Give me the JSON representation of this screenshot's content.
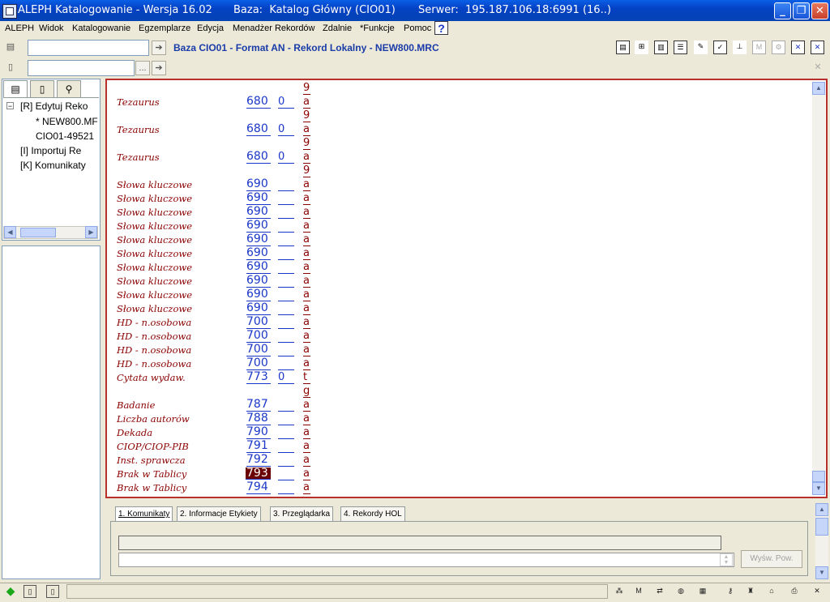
{
  "window": {
    "title": "ALEPH Katalogowanie - Wersja 16.02",
    "base_label": "Baza:  Katalog Główny (CIO01)",
    "server_label": "Serwer:  195.187.106.18:6991 (16..)",
    "min_icon": "minimize-icon",
    "max_icon": "restore-icon",
    "close_icon": "close-icon"
  },
  "menu": {
    "items": [
      "ALEPH",
      "Widok",
      "Katalogowanie",
      "Egzemplarze",
      "Edycja",
      "Menadżer Rekordów",
      "Zdalnie",
      "*Funkcje",
      "Pomoc"
    ],
    "help_glyph": "?"
  },
  "toolbar": {
    "record_title": "Baza CIO01 - Format AN - Rekord Lokalny - NEW800.MRC",
    "input1_value": "",
    "input2_value": "",
    "browse_label": "..."
  },
  "tree": {
    "items": [
      {
        "text": "[R] Edytuj Reko"
      },
      {
        "text": "* NEW800.MF"
      },
      {
        "text": "CIO01-49521"
      },
      {
        "text": "[I] Importuj Re"
      },
      {
        "text": "[K] Komunikaty"
      }
    ]
  },
  "editor": {
    "rows": [
      {
        "label": "",
        "tag": "",
        "ind": "",
        "sub": "9"
      },
      {
        "label": "Tezaurus",
        "tag": "680",
        "ind": "0",
        "sub": "a"
      },
      {
        "label": "",
        "tag": "",
        "ind": "",
        "sub": "9"
      },
      {
        "label": "Tezaurus",
        "tag": "680",
        "ind": "0",
        "sub": "a"
      },
      {
        "label": "",
        "tag": "",
        "ind": "",
        "sub": "9"
      },
      {
        "label": "Tezaurus",
        "tag": "680",
        "ind": "0",
        "sub": "a"
      },
      {
        "label": "",
        "tag": "",
        "ind": "",
        "sub": "9"
      },
      {
        "label": "Słowa kluczowe",
        "tag": "690",
        "ind": "",
        "sub": "a"
      },
      {
        "label": "Słowa kluczowe",
        "tag": "690",
        "ind": "",
        "sub": "a"
      },
      {
        "label": "Słowa kluczowe",
        "tag": "690",
        "ind": "",
        "sub": "a"
      },
      {
        "label": "Słowa kluczowe",
        "tag": "690",
        "ind": "",
        "sub": "a"
      },
      {
        "label": "Słowa kluczowe",
        "tag": "690",
        "ind": "",
        "sub": "a"
      },
      {
        "label": "Słowa kluczowe",
        "tag": "690",
        "ind": "",
        "sub": "a"
      },
      {
        "label": "Słowa kluczowe",
        "tag": "690",
        "ind": "",
        "sub": "a"
      },
      {
        "label": "Słowa kluczowe",
        "tag": "690",
        "ind": "",
        "sub": "a"
      },
      {
        "label": "Słowa kluczowe",
        "tag": "690",
        "ind": "",
        "sub": "a"
      },
      {
        "label": "Słowa kluczowe",
        "tag": "690",
        "ind": "",
        "sub": "a"
      },
      {
        "label": "HD - n.osobowa",
        "tag": "700",
        "ind": "",
        "sub": "a"
      },
      {
        "label": "HD - n.osobowa",
        "tag": "700",
        "ind": "",
        "sub": "a"
      },
      {
        "label": "HD - n.osobowa",
        "tag": "700",
        "ind": "",
        "sub": "a"
      },
      {
        "label": "HD - n.osobowa",
        "tag": "700",
        "ind": "",
        "sub": "a"
      },
      {
        "label": "Cytata wydaw.",
        "tag": "773",
        "ind": "0",
        "sub": "t"
      },
      {
        "label": "",
        "tag": "",
        "ind": "",
        "sub": "g"
      },
      {
        "label": "Badanie",
        "tag": "787",
        "ind": "",
        "sub": "a"
      },
      {
        "label": "Liczba autorów",
        "tag": "788",
        "ind": "",
        "sub": "a"
      },
      {
        "label": "Dekada",
        "tag": "790",
        "ind": "",
        "sub": "a"
      },
      {
        "label": "CIOP/CIOP-PIB",
        "tag": "791",
        "ind": "",
        "sub": "a"
      },
      {
        "label": "Inst. sprawcza",
        "tag": "792",
        "ind": "",
        "sub": "a"
      },
      {
        "label": "Brak w Tablicy",
        "tag": "793",
        "ind": "",
        "sub": "a",
        "selected": true
      },
      {
        "label": "Brak w Tablicy",
        "tag": "794",
        "ind": "",
        "sub": "a"
      }
    ]
  },
  "bottom": {
    "tabs": [
      "1. Komunikaty",
      "2. Informacje Etykiety",
      "3. Przeglądarka",
      "4. Rekordy HOL"
    ],
    "active_tab": 0,
    "button_label": "Wyśw. Pow."
  },
  "colors": {
    "titlebar": "#0a5fe6",
    "field_label": "#8b0000",
    "tag_blue": "#1a36c8",
    "selection": "#6a0000",
    "editor_border": "#b8302c"
  }
}
